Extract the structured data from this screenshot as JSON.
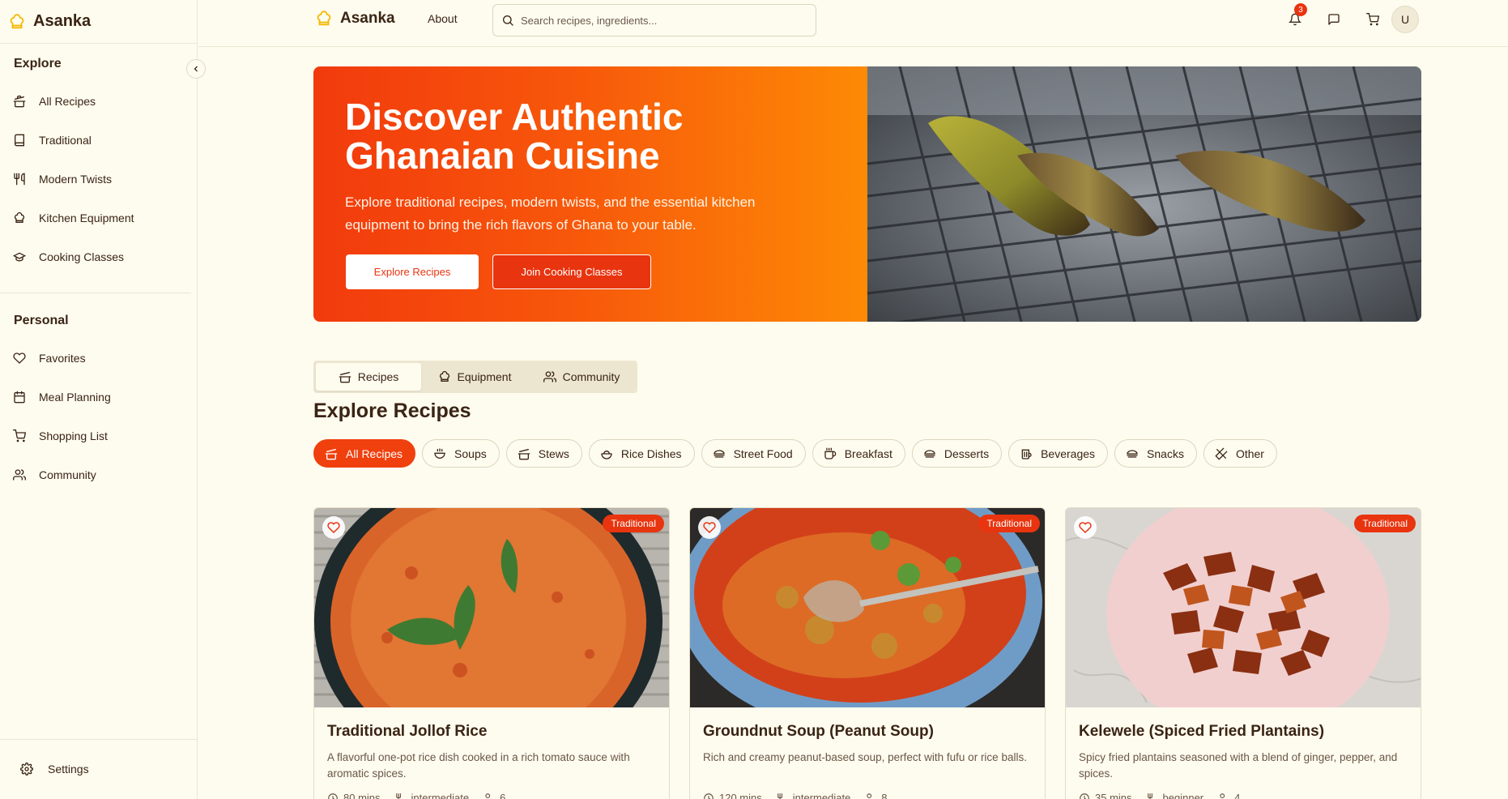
{
  "app": {
    "brand": "Asanka"
  },
  "sidebar": {
    "explore_title": "Explore",
    "explore_items": [
      {
        "label": "All Recipes",
        "icon": "pot-icon"
      },
      {
        "label": "Traditional",
        "icon": "book-icon"
      },
      {
        "label": "Modern Twists",
        "icon": "utensils-icon"
      },
      {
        "label": "Kitchen Equipment",
        "icon": "chef-hat-icon"
      },
      {
        "label": "Cooking Classes",
        "icon": "graduation-cap-icon"
      }
    ],
    "personal_title": "Personal",
    "personal_items": [
      {
        "label": "Favorites",
        "icon": "heart-icon"
      },
      {
        "label": "Meal Planning",
        "icon": "calendar-icon"
      },
      {
        "label": "Shopping List",
        "icon": "cart-icon"
      },
      {
        "label": "Community",
        "icon": "users-icon"
      }
    ],
    "settings_label": "Settings"
  },
  "header": {
    "brand": "Asanka",
    "about": "About",
    "search_placeholder": "Search recipes, ingredients...",
    "notification_count": "3",
    "avatar_initial": "U"
  },
  "hero": {
    "title": "Discover Authentic Ghanaian Cuisine",
    "subtitle": "Explore traditional recipes, modern twists, and the essential kitchen equipment to bring the rich flavors of Ghana to your table.",
    "primary_button": "Explore Recipes",
    "secondary_button": "Join Cooking Classes"
  },
  "tabs": [
    {
      "label": "Recipes",
      "active": true
    },
    {
      "label": "Equipment",
      "active": false
    },
    {
      "label": "Community",
      "active": false
    }
  ],
  "section_title": "Explore Recipes",
  "categories": [
    {
      "label": "All Recipes",
      "active": true
    },
    {
      "label": "Soups"
    },
    {
      "label": "Stews"
    },
    {
      "label": "Rice Dishes"
    },
    {
      "label": "Street Food"
    },
    {
      "label": "Breakfast"
    },
    {
      "label": "Desserts"
    },
    {
      "label": "Beverages"
    },
    {
      "label": "Snacks"
    },
    {
      "label": "Other"
    }
  ],
  "recipes": [
    {
      "title": "Traditional Jollof Rice",
      "badge": "Traditional",
      "description": "A flavorful one-pot rice dish cooked in a rich tomato sauce with aromatic spices.",
      "time": "80 mins",
      "difficulty": "intermediate",
      "servings": "6"
    },
    {
      "title": "Groundnut Soup (Peanut Soup)",
      "badge": "Traditional",
      "description": "Rich and creamy peanut-based soup, perfect with fufu or rice balls.",
      "time": "120 mins",
      "difficulty": "intermediate",
      "servings": "8"
    },
    {
      "title": "Kelewele (Spiced Fried Plantains)",
      "badge": "Traditional",
      "description": "Spicy fried plantains seasoned with a blend of ginger, pepper, and spices.",
      "time": "35 mins",
      "difficulty": "beginner",
      "servings": "4"
    }
  ],
  "colors": {
    "accent": "#e8340f",
    "background": "#fefcef",
    "text": "#3a2414"
  }
}
